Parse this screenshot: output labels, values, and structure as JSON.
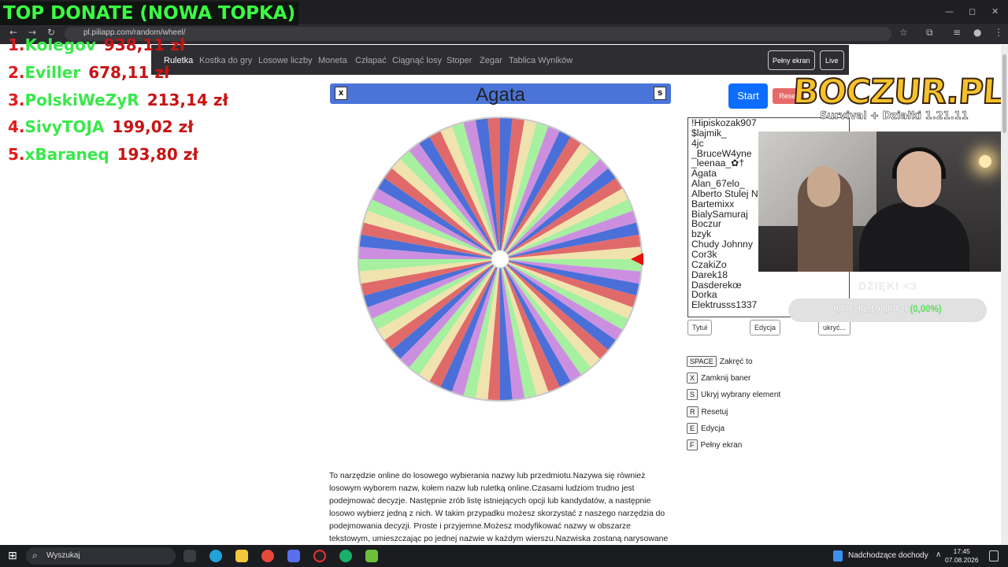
{
  "browser": {
    "url": "pl.piliapp.com/random/wheel/",
    "window_controls": [
      "—",
      "◻",
      "✕"
    ]
  },
  "overlay": {
    "title": "TOP DONATE (NOWA TOPKA)",
    "ranking": [
      {
        "num": "1.",
        "name": "Kolegov",
        "amount": "938,11 zł"
      },
      {
        "num": "2.",
        "name": "Eviller",
        "amount": "678,11 zł"
      },
      {
        "num": "3.",
        "name": "PolskiWeZyR",
        "amount": "213,14 zł"
      },
      {
        "num": "4.",
        "name": "SivyTOJA",
        "amount": "199,02 zł"
      },
      {
        "num": "5.",
        "name": "xBaraneq",
        "amount": "193,80 zł"
      }
    ]
  },
  "nav": {
    "links": [
      "Ruletka",
      "Kostka do gry",
      "Losowe liczby",
      "Moneta",
      "Człapać",
      "Ciągnąć losy",
      "Stoper",
      "Zegar",
      "Tablica Wyników"
    ],
    "fullscreen": "Pełny ekran",
    "live": "Live"
  },
  "wheel": {
    "selected": "Agata",
    "close_key": "x",
    "hide_key": "s",
    "start": "Start",
    "reset": "Reset",
    "colors": [
      "#4a6fd8",
      "#e06a6a",
      "#f1e3ae",
      "#a6f0a0",
      "#cc8fe0"
    ],
    "names": [
      "!Hipiskozak907",
      "$lajmik_",
      "4jc",
      "_BruceW4yne",
      "_leenaa_✿†",
      "Agata",
      "Alan_67elo_",
      "Alberto Stulej Noga",
      "Bartemixx",
      "BialySamuraj",
      "Boczur",
      "bzyk",
      "Chudy Johnny",
      "Cor3k",
      "CzakiZo",
      "Darek18",
      "Dasderekœ",
      "Dorka",
      "Elektrusss1337"
    ]
  },
  "list_buttons": {
    "title": "Tytuł",
    "edit": "Edycja",
    "hide": "ukryć..."
  },
  "shortcuts": [
    {
      "key": "SPACE",
      "label": "Zakręć to"
    },
    {
      "key": "X",
      "label": "Zamknij baner"
    },
    {
      "key": "S",
      "label": "Ukryj wybrany element"
    },
    {
      "key": "R",
      "label": "Resetuj"
    },
    {
      "key": "E",
      "label": "Edycja"
    },
    {
      "key": "F",
      "label": "Pełny ekran"
    }
  ],
  "description": "To narzędzie online do losowego wybierania nazwy lub przedmiotu.Nazywa się również losowym wyborem nazw, kołem nazw lub ruletką online.Czasami ludziom trudno jest podejmować decyzje. Następnie zrób listę istniejących opcji lub kandydatów, a następnie losowo wybierz jedną z nich. W takim przypadku możesz skorzystać z naszego narzędzia do podejmowania decyzji. Proste i przyjemne.Możesz modyfikować nazwy w obszarze tekstowym, umieszczając po jednej nazwie w każdym wierszu.Nazwiska zostaną narysowane",
  "stream": {
    "logo": "BOCZUR.PL",
    "logo_sub": "Survival + Działki 1.21.11",
    "thanks": "DZIĘKI <3",
    "goal_text": "0,00 zł z 100,00 zł",
    "goal_pct": "(0,00%)",
    "goal_fraction": 0
  },
  "taskbar": {
    "search": "Wyszukaj",
    "weather": "Nadchodzące dochody",
    "time": "17:45",
    "date": "07.08.2026"
  }
}
